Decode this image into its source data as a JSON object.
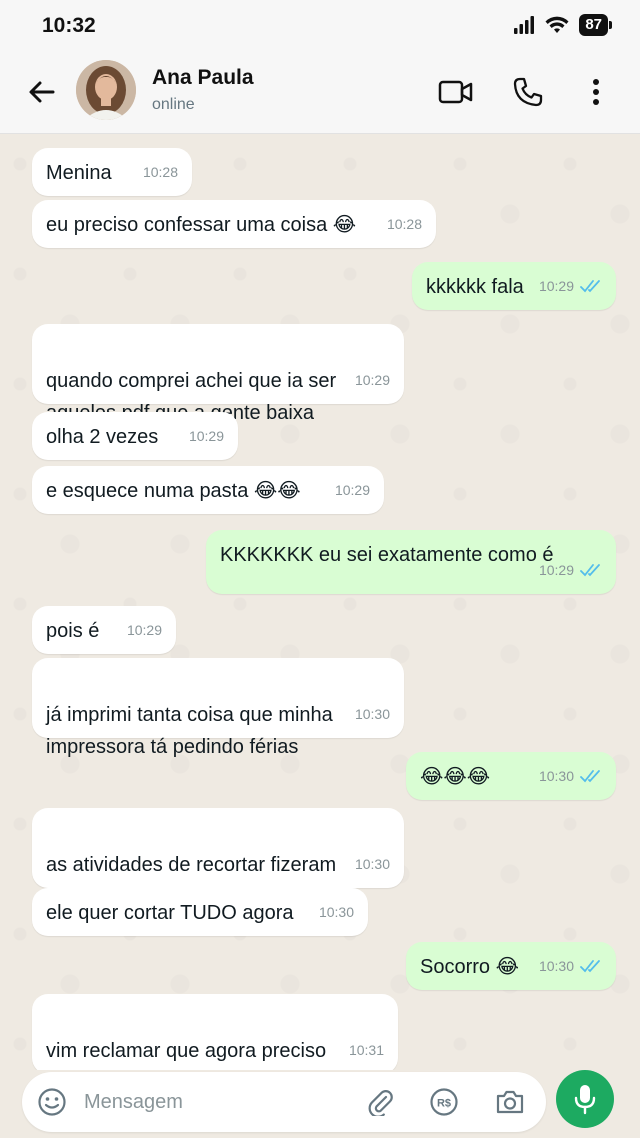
{
  "status_bar": {
    "time": "10:32",
    "battery": "87"
  },
  "header": {
    "contact_name": "Ana Paula",
    "contact_status": "online"
  },
  "messages": [
    {
      "dir": "in",
      "text": "Menina",
      "time": "10:28"
    },
    {
      "dir": "in",
      "text": "eu preciso confessar uma coisa 😂",
      "time": "10:28"
    },
    {
      "dir": "out",
      "text": "kkkkkk fala",
      "time": "10:29",
      "read": true
    },
    {
      "dir": "in",
      "text": "quando comprei achei que ia ser\naqueles pdf que a gente baixa",
      "time": "10:29"
    },
    {
      "dir": "in",
      "text": "olha 2 vezes",
      "time": "10:29"
    },
    {
      "dir": "in",
      "text": "e esquece numa pasta 😂😂",
      "time": "10:29"
    },
    {
      "dir": "out",
      "text": "KKKKKKK eu sei exatamente como é",
      "time": "10:29",
      "read": true
    },
    {
      "dir": "in",
      "text": "pois é",
      "time": "10:29"
    },
    {
      "dir": "in",
      "text": "já imprimi tanta coisa que minha\nimpressora tá pedindo férias",
      "time": "10:30"
    },
    {
      "dir": "out",
      "text": "😂😂😂",
      "time": "10:30",
      "read": true
    },
    {
      "dir": "in",
      "text": "as atividades de recortar fizeram\nsucesso aqui",
      "time": "10:30"
    },
    {
      "dir": "in",
      "text": "ele quer cortar TUDO agora",
      "time": "10:30"
    },
    {
      "dir": "out",
      "text": "Socorro 😂",
      "time": "10:30",
      "read": true
    },
    {
      "dir": "in",
      "text": "vim reclamar que agora preciso\nesconder a tesoura kkkkk",
      "time": "10:31"
    }
  ],
  "input": {
    "placeholder": "Mensagem"
  },
  "colors": {
    "incoming": "#ffffff",
    "outgoing": "#d9fdd3",
    "read_ticks": "#53bdeb",
    "accent": "#1daa61"
  }
}
